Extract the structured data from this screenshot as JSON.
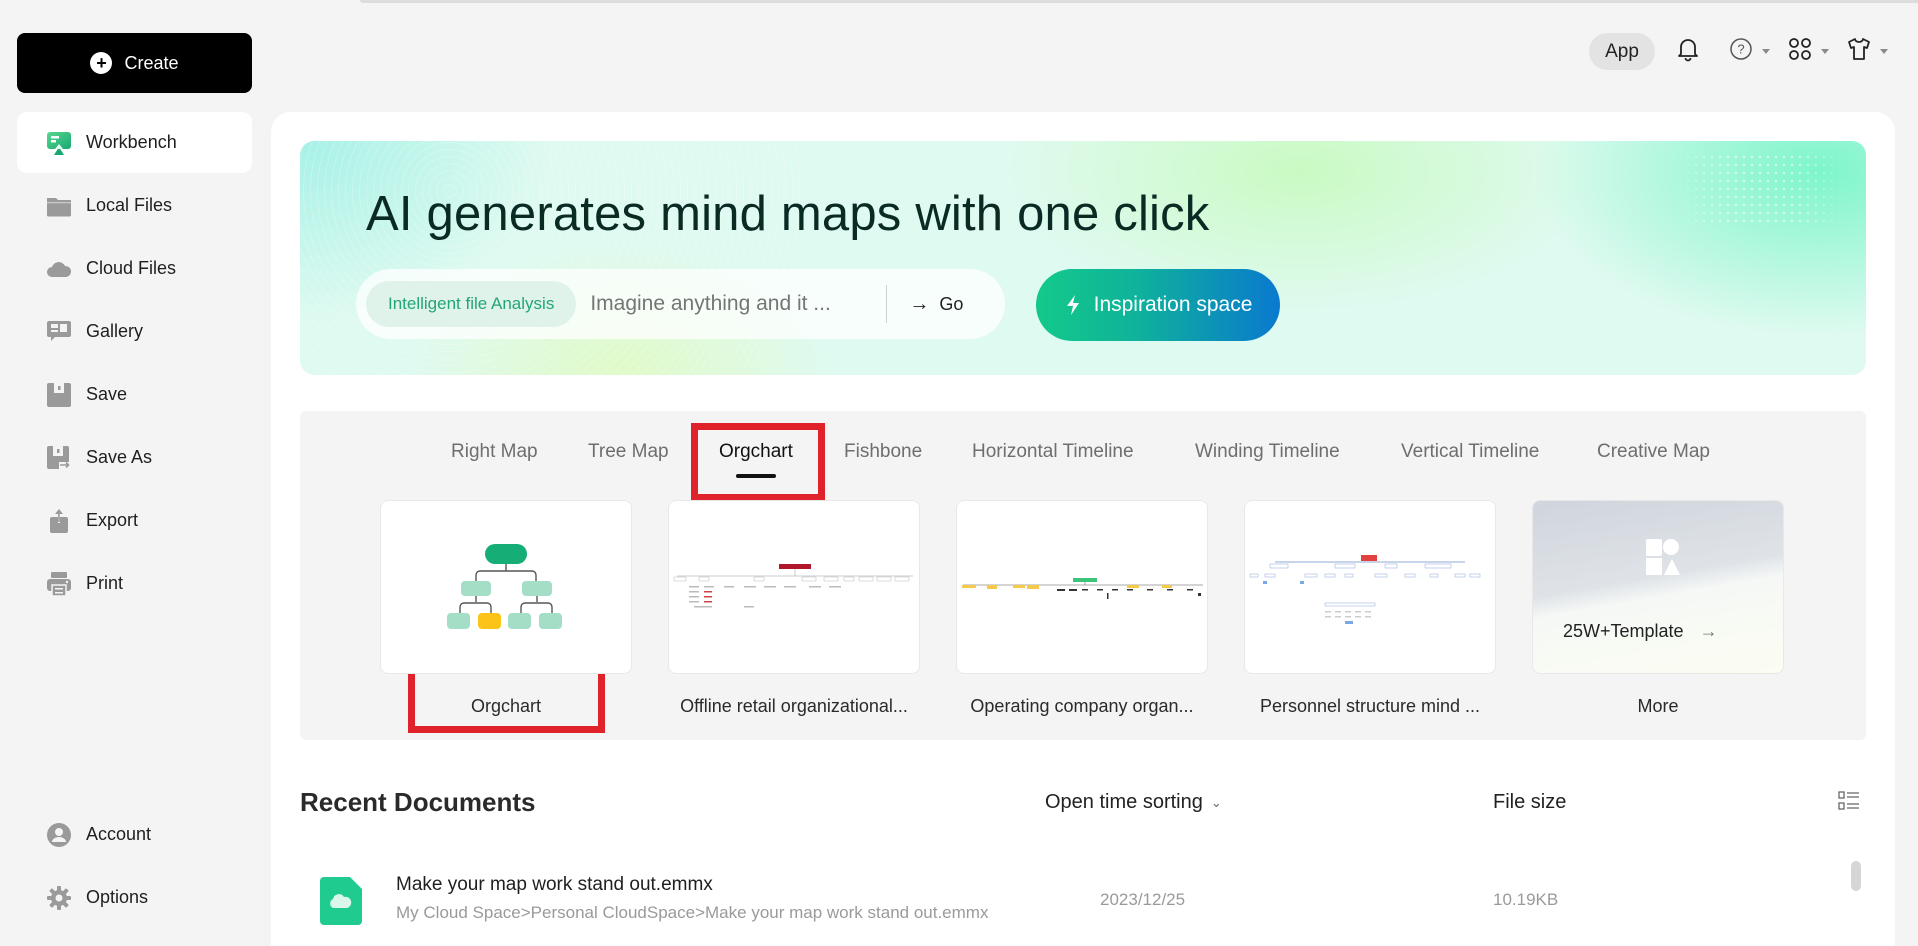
{
  "sidebar": {
    "create_label": "Create",
    "items": [
      {
        "label": "Workbench",
        "icon": "workbench-icon",
        "active": true
      },
      {
        "label": "Local Files",
        "icon": "folder-icon"
      },
      {
        "label": "Cloud Files",
        "icon": "cloud-icon"
      },
      {
        "label": "Gallery",
        "icon": "gallery-icon"
      },
      {
        "label": "Save",
        "icon": "save-icon"
      },
      {
        "label": "Save As",
        "icon": "save-as-icon"
      },
      {
        "label": "Export",
        "icon": "export-icon"
      },
      {
        "label": "Print",
        "icon": "print-icon"
      }
    ],
    "bottom_items": [
      {
        "label": "Account",
        "icon": "account-icon"
      },
      {
        "label": "Options",
        "icon": "gear-icon"
      }
    ]
  },
  "header": {
    "app_label": "App",
    "icons": [
      "bell-icon",
      "help-icon",
      "apps-icon",
      "skin-icon"
    ]
  },
  "banner": {
    "title": "AI generates mind maps with one click",
    "chip_label": "Intelligent file Analysis",
    "input_placeholder": "Imagine anything and it ...",
    "go_label": "Go",
    "inspiration_label": "Inspiration space"
  },
  "templates": {
    "tabs": [
      {
        "label": "Right Map"
      },
      {
        "label": "Tree Map"
      },
      {
        "label": "Orgchart",
        "active": true
      },
      {
        "label": "Fishbone"
      },
      {
        "label": "Horizontal Timeline"
      },
      {
        "label": "Winding Timeline"
      },
      {
        "label": "Vertical Timeline"
      },
      {
        "label": "Creative Map"
      }
    ],
    "cards": [
      {
        "label": "Orgchart"
      },
      {
        "label": "Offline retail organizational..."
      },
      {
        "label": "Operating company organ..."
      },
      {
        "label": "Personnel structure mind ..."
      },
      {
        "label": "More",
        "overlay_text": "25W+Template"
      }
    ]
  },
  "recent": {
    "title": "Recent Documents",
    "sort_label": "Open time sorting",
    "file_size_header": "File size",
    "documents": [
      {
        "name": "Make your map work stand out.emmx",
        "path": "My Cloud Space>Personal CloudSpace>Make your map work stand out.emmx",
        "date": "2023/12/25",
        "size": "10.19KB"
      }
    ]
  },
  "colors": {
    "accent_green": "#13c98a",
    "accent_blue": "#0a79cf",
    "highlight_red": "#e0222b",
    "chip_text": "#22a774"
  }
}
